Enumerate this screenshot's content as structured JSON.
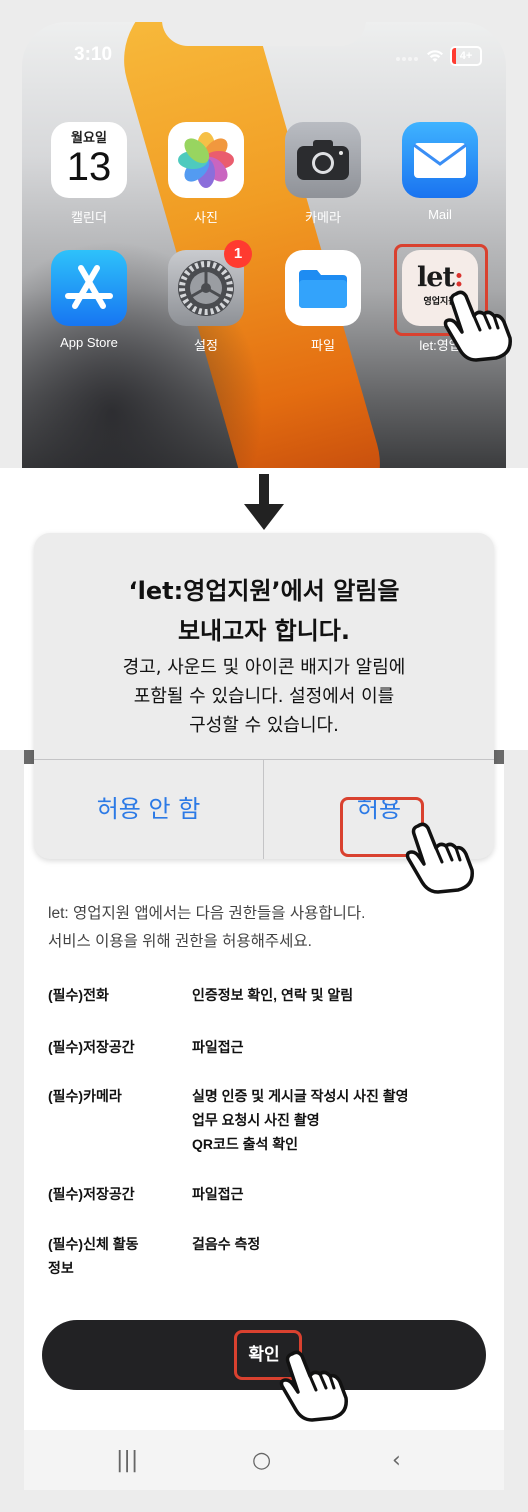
{
  "status_bar": {
    "time": "3:10",
    "battery": "4+"
  },
  "home_apps": [
    {
      "name": "캘린더",
      "day": "월요일",
      "date": "13"
    },
    {
      "name": "사진"
    },
    {
      "name": "카메라"
    },
    {
      "name": "Mail"
    },
    {
      "name": "App Store"
    },
    {
      "name": "설정",
      "badge": "1"
    },
    {
      "name": "파일"
    },
    {
      "name": "let:영업",
      "logo": "let:",
      "logo_sub": "영업지원"
    }
  ],
  "alert": {
    "title_line1": "‘let:영업지원’에서 알림을",
    "title_line2": "보내고자 합니다.",
    "message_line1": "경고, 사운드 및 아이콘 배지가 알림에",
    "message_line2": "포함될 수 있습니다. 설정에서 이를",
    "message_line3": "구성할 수 있습니다.",
    "deny_label": "허용 안 함",
    "allow_label": "허용"
  },
  "permissions_screen": {
    "intro_line1": "let: 영업지원 앱에서는 다음 권한들을 사용합니다.",
    "intro_line2": "서비스 이용을 위해 권한을 허용해주세요.",
    "items": [
      {
        "name": "(필수)전화",
        "desc": [
          "인증정보 확인, 연락 및 알림"
        ]
      },
      {
        "name": "(필수)저장공간",
        "desc": [
          "파일접근"
        ]
      },
      {
        "name": "(필수)카메라",
        "desc": [
          "실명 인증 및 게시글 작성시 사진 촬영",
          "업무 요청시 사진 촬영",
          "QR코드 출석 확인"
        ]
      },
      {
        "name": "(필수)저장공간",
        "desc": [
          "파일접근"
        ]
      },
      {
        "name_line1": "(필수)신체 활동",
        "name_line2": "정보",
        "desc": [
          "걸음수 측정"
        ]
      }
    ],
    "confirm_label": "확인"
  },
  "nav_bar": {
    "recents": "|||",
    "home": "○",
    "back": "‹"
  },
  "colors": {
    "highlight": "#d9412f",
    "ios_blue": "#2c7ae6",
    "confirm_bg": "#222224"
  }
}
